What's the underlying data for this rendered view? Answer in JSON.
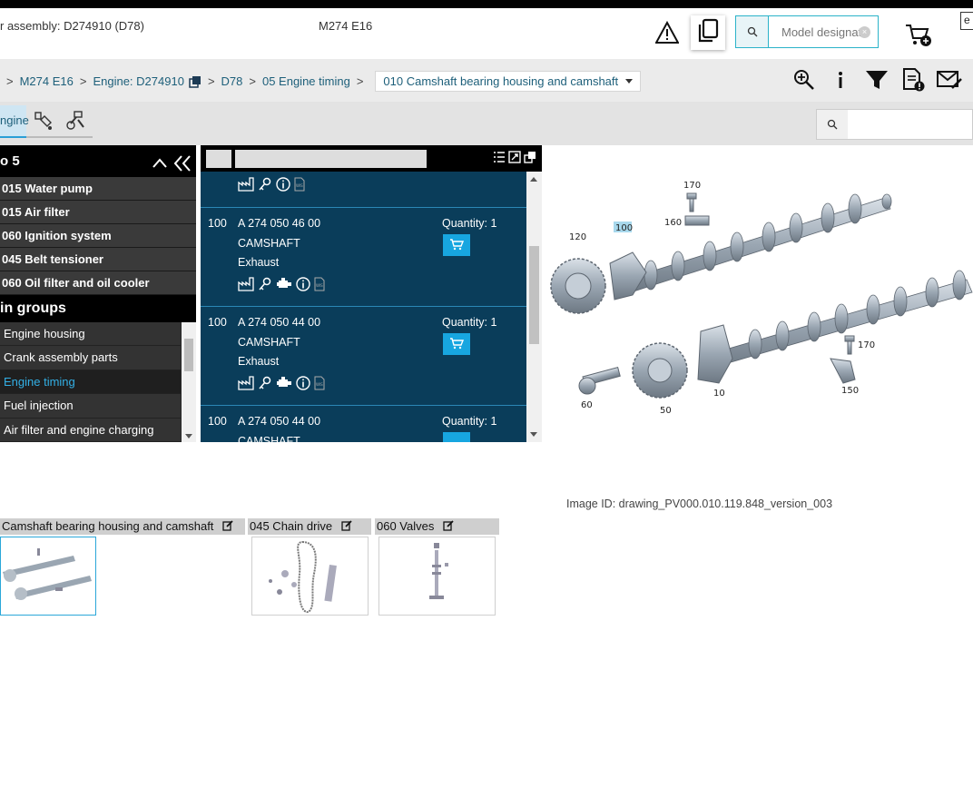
{
  "header": {
    "assembly": "r assembly: D274910 (D78)",
    "model": "M274 E16",
    "search_placeholder": "Model designat",
    "corner": "e"
  },
  "breadcrumb": {
    "items": [
      "M274 E16",
      "Engine: D274910",
      "D78",
      "05 Engine timing"
    ],
    "current": "010 Camshaft bearing housing and camshaft"
  },
  "tabs": {
    "active": "ngine"
  },
  "left_panel": {
    "title": "o 5",
    "subgroups": [
      "015 Water pump",
      "015 Air filter",
      "060 Ignition system",
      "045 Belt tensioner",
      "060 Oil filter and oil cooler"
    ],
    "groups_title": "in groups",
    "groups": [
      "Engine housing",
      "Crank assembly parts",
      "Engine timing",
      "Fuel injection",
      "Air filter and engine charging"
    ],
    "active_group": "Engine timing"
  },
  "parts": [
    {
      "pos": "100",
      "part_no": "A 274 050 46 00",
      "name": "CAMSHAFT",
      "note": "Exhaust",
      "qty": "Quantity: 1"
    },
    {
      "pos": "100",
      "part_no": "A 274 050 44 00",
      "name": "CAMSHAFT",
      "note": "Exhaust",
      "qty": "Quantity: 1"
    },
    {
      "pos": "100",
      "part_no": "A 274 050 44 00",
      "name": "CAMSHAFT",
      "note": "",
      "qty": "Quantity: 1"
    }
  ],
  "drawing": {
    "callouts": [
      "170",
      "160",
      "100",
      "120",
      "170",
      "150",
      "10",
      "50",
      "60"
    ],
    "image_id": "Image ID: drawing_PV000.010.119.848_version_003"
  },
  "thumbnails": [
    {
      "label": "Camshaft bearing housing and camshaft"
    },
    {
      "label": "045 Chain drive"
    },
    {
      "label": "060 Valves"
    }
  ],
  "colors": {
    "accent": "#17a6e0",
    "panel": "#0a3d5a",
    "nav_dark": "#2a2a2a"
  }
}
